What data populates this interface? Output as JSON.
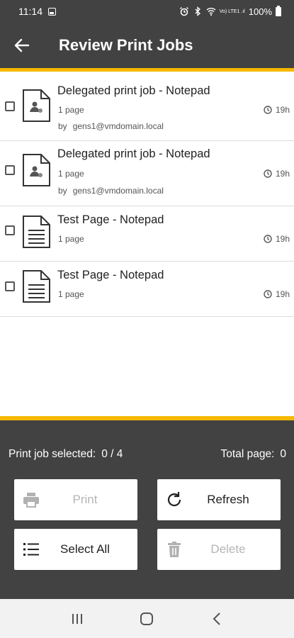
{
  "status_bar": {
    "time": "11:14",
    "carrier_text": "Vo) LTE1 .ıl",
    "battery": "100%"
  },
  "app_bar": {
    "title": "Review Print Jobs"
  },
  "jobs": [
    {
      "title": "Delegated print job - Notepad",
      "pages": "1  page",
      "by_label": "by",
      "owner": "gens1@vmdomain.local",
      "time": "19h",
      "icon": "delegated-document-icon"
    },
    {
      "title": "Delegated print job - Notepad",
      "pages": "1  page",
      "by_label": "by",
      "owner": "gens1@vmdomain.local",
      "time": "19h",
      "icon": "delegated-document-icon"
    },
    {
      "title": "Test Page - Notepad",
      "pages": "1  page",
      "time": "19h",
      "icon": "document-icon"
    },
    {
      "title": "Test Page - Notepad",
      "pages": "1  page",
      "time": "19h",
      "icon": "document-icon"
    }
  ],
  "summary": {
    "selected_label": "Print job selected:",
    "selected_value": "0 / 4",
    "total_label": "Total page:",
    "total_value": "0"
  },
  "buttons": {
    "print": "Print",
    "refresh": "Refresh",
    "select_all": "Select All",
    "delete": "Delete"
  },
  "colors": {
    "app_bar": "#424242",
    "accent": "#f5b800",
    "disabled_text": "#b5b5b5"
  }
}
